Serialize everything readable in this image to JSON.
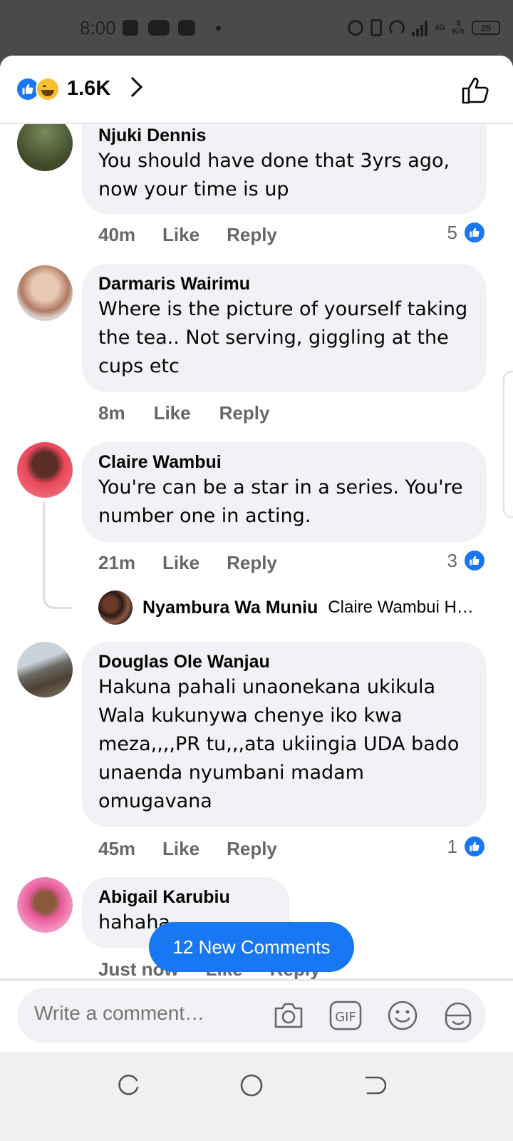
{
  "status_bar": {
    "time": "8:00",
    "network_label": "4G",
    "speed_value": "5",
    "speed_unit": "K/s",
    "battery": "25"
  },
  "header": {
    "reaction_count": "1.6K",
    "reactions": [
      "like-icon",
      "haha-icon"
    ]
  },
  "comments": [
    {
      "name": "Njuki Dennis",
      "text": "You should have done that 3yrs ago, now your time is up",
      "time": "40m",
      "like_label": "Like",
      "reply_label": "Reply",
      "like_count": "5"
    },
    {
      "name": "Darmaris Wairimu",
      "text": "Where is the picture of yourself taking the tea.. Not serving, giggling at the cups etc",
      "time": "8m",
      "like_label": "Like",
      "reply_label": "Reply"
    },
    {
      "name": "Claire Wambui",
      "text": "You're can be a star in a series. You're number one in acting.",
      "time": "21m",
      "like_label": "Like",
      "reply_label": "Reply",
      "like_count": "3",
      "reply": {
        "name": "Nyambura Wa Muniu",
        "text": "Claire Wambui H…"
      }
    },
    {
      "name": "Douglas Ole Wanjau",
      "text": "Hakuna pahali unaonekana ukikula Wala kukunywa chenye iko kwa meza,,,,PR tu,,,ata ukiingia UDA bado unaenda nyumbani madam omugavana",
      "time": "45m",
      "like_label": "Like",
      "reply_label": "Reply",
      "like_count": "1"
    },
    {
      "name": "Abigail Karubiu",
      "text": "hahaha",
      "time": "Just now",
      "like_label": "Like",
      "reply_label": "Reply"
    }
  ],
  "new_comments_label": "12 New Comments",
  "composer": {
    "placeholder": "Write a comment…",
    "icons": [
      "camera-icon",
      "gif-icon",
      "emoji-icon",
      "sticker-icon"
    ]
  },
  "colors": {
    "accent": "#1877f2",
    "bubble": "#f0f2f5",
    "meta_text": "#65676b"
  }
}
